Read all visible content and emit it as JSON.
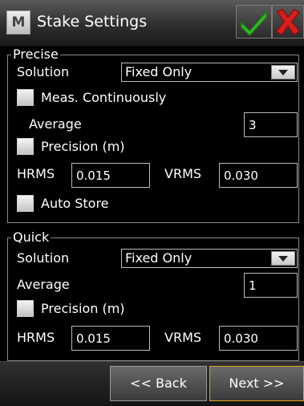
{
  "window": {
    "title": "Stake Settings",
    "app_icon": "M",
    "icons": {
      "app": "app-logo-icon",
      "ok": "green-check-icon",
      "close": "red-x-icon"
    }
  },
  "precise": {
    "legend": "Precise",
    "solution_label": "Solution",
    "solution_value": "Fixed Only",
    "meas_continuously_label": "Meas. Continuously",
    "meas_continuously_checked": false,
    "average_label": "Average",
    "average_value": "3",
    "precision_label": "Precision (m)",
    "precision_checked": false,
    "hrms_label": "HRMS",
    "hrms_value": "0.015",
    "vrms_label": "VRMS",
    "vrms_value": "0.030",
    "auto_store_label": "Auto Store",
    "auto_store_checked": false
  },
  "quick": {
    "legend": "Quick",
    "solution_label": "Solution",
    "solution_value": "Fixed Only",
    "average_label": "Average",
    "average_value": "1",
    "precision_label": "Precision (m)",
    "precision_checked": false,
    "hrms_label": "HRMS",
    "hrms_value": "0.015",
    "vrms_label": "VRMS",
    "vrms_value": "0.030"
  },
  "footer": {
    "back_label": "<< Back",
    "next_label": "Next >>"
  },
  "colors": {
    "accent_next_border": "#e0a020",
    "check_green": "#3cb82b",
    "close_red": "#d42020"
  }
}
